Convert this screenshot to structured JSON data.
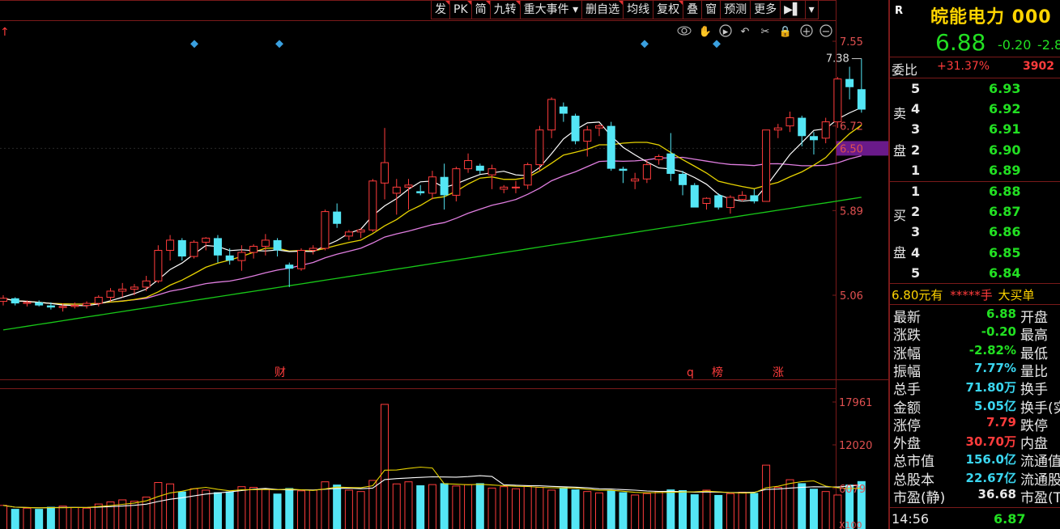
{
  "toolbar": {
    "buttons": [
      {
        "name": "fa",
        "label": "发"
      },
      {
        "name": "pk",
        "label": "PK"
      },
      {
        "name": "jian",
        "label": "简"
      },
      {
        "name": "jiuzhuan",
        "label": "九转"
      },
      {
        "name": "zhongda",
        "label": "重大事件 ▾"
      },
      {
        "name": "shanzixuan",
        "label": "删自选"
      },
      {
        "name": "junxian",
        "label": "均线"
      },
      {
        "name": "fuquan",
        "label": "复权"
      },
      {
        "name": "die",
        "label": "叠"
      },
      {
        "name": "chuang",
        "label": "窗"
      },
      {
        "name": "yuce",
        "label": "预测"
      },
      {
        "name": "gengduo",
        "label": "更多"
      },
      {
        "name": "expand",
        "label": "▶▌"
      },
      {
        "name": "menu",
        "label": "▾"
      }
    ]
  },
  "chart_icons": [
    "eye-icon",
    "hand-icon",
    "play-icon",
    "undo-icon",
    "scissors-icon",
    "lock-icon",
    "zoom-in-icon",
    "zoom-out-icon"
  ],
  "price_axis": {
    "labels": [
      "7.55",
      "6.72",
      "6.50",
      "5.89",
      "5.06"
    ],
    "highlight": "6.50"
  },
  "volume_axis": {
    "labels": [
      "17961",
      "12020",
      "6079",
      "X100"
    ]
  },
  "markers": {
    "cai": "财",
    "q": "q",
    "bang": "榜",
    "zhang": "涨"
  },
  "high_label": "7.38",
  "up_arrow": "↑",
  "colors": {
    "up": "#ff3c3c",
    "down": "#54e6f5",
    "ma5": "#ffffff",
    "ma10": "#e6d200",
    "ma20": "#e07ee0",
    "ma60": "#18c818",
    "frame": "#7a1a1a"
  },
  "chart_data": {
    "type": "candlestick",
    "y_range": [
      5.06,
      7.55
    ],
    "y_ticks": [
      7.55,
      6.72,
      5.89,
      5.06
    ],
    "current_price_line": 6.5,
    "ohlc": [
      [
        5.0,
        5.06,
        4.96,
        5.03
      ],
      [
        5.03,
        5.04,
        4.96,
        4.98
      ],
      [
        4.98,
        5.01,
        4.95,
        4.99
      ],
      [
        4.99,
        5.01,
        4.95,
        4.96
      ],
      [
        4.96,
        4.99,
        4.92,
        4.94
      ],
      [
        4.94,
        4.98,
        4.9,
        4.95
      ],
      [
        4.95,
        4.99,
        4.93,
        4.96
      ],
      [
        4.96,
        5.0,
        4.93,
        4.98
      ],
      [
        4.98,
        5.06,
        4.95,
        5.04
      ],
      [
        5.04,
        5.13,
        5.0,
        5.1
      ],
      [
        5.1,
        5.18,
        5.04,
        5.12
      ],
      [
        5.12,
        5.17,
        5.06,
        5.14
      ],
      [
        5.14,
        5.25,
        5.1,
        5.2
      ],
      [
        5.2,
        5.55,
        5.18,
        5.5
      ],
      [
        5.5,
        5.65,
        5.4,
        5.6
      ],
      [
        5.6,
        5.62,
        5.4,
        5.44
      ],
      [
        5.44,
        5.6,
        5.42,
        5.58
      ],
      [
        5.58,
        5.63,
        5.5,
        5.62
      ],
      [
        5.62,
        5.65,
        5.38,
        5.45
      ],
      [
        5.45,
        5.52,
        5.36,
        5.4
      ],
      [
        5.4,
        5.55,
        5.3,
        5.48
      ],
      [
        5.48,
        5.56,
        5.42,
        5.54
      ],
      [
        5.54,
        5.66,
        5.45,
        5.6
      ],
      [
        5.6,
        5.62,
        5.44,
        5.5
      ],
      [
        5.36,
        5.38,
        5.14,
        5.32
      ],
      [
        5.32,
        5.52,
        5.3,
        5.5
      ],
      [
        5.5,
        5.55,
        5.46,
        5.52
      ],
      [
        5.52,
        5.9,
        5.5,
        5.88
      ],
      [
        5.88,
        5.96,
        5.72,
        5.76
      ],
      [
        5.64,
        5.7,
        5.6,
        5.68
      ],
      [
        5.68,
        5.72,
        5.62,
        5.7
      ],
      [
        5.7,
        6.2,
        5.68,
        6.18
      ],
      [
        6.16,
        6.7,
        6.0,
        6.36
      ],
      [
        6.06,
        6.2,
        5.85,
        6.12
      ],
      [
        6.12,
        6.2,
        5.9,
        6.14
      ],
      [
        6.08,
        6.14,
        6.04,
        6.06
      ],
      [
        6.06,
        6.28,
        6.0,
        6.22
      ],
      [
        6.22,
        6.35,
        5.9,
        6.04
      ],
      [
        6.04,
        6.32,
        5.98,
        6.3
      ],
      [
        6.3,
        6.45,
        6.26,
        6.38
      ],
      [
        6.33,
        6.35,
        6.25,
        6.28
      ],
      [
        6.24,
        6.34,
        6.1,
        6.3
      ],
      [
        6.1,
        6.14,
        6.06,
        6.12
      ],
      [
        6.12,
        6.18,
        6.06,
        6.12
      ],
      [
        6.14,
        6.36,
        6.1,
        6.34
      ],
      [
        6.34,
        6.72,
        6.28,
        6.68
      ],
      [
        6.68,
        7.0,
        6.6,
        6.98
      ],
      [
        6.91,
        6.95,
        6.76,
        6.84
      ],
      [
        6.82,
        6.84,
        6.54,
        6.57
      ],
      [
        6.57,
        6.72,
        6.42,
        6.68
      ],
      [
        6.7,
        6.74,
        6.62,
        6.72
      ],
      [
        6.72,
        6.76,
        6.28,
        6.3
      ],
      [
        6.3,
        6.32,
        6.16,
        6.28
      ],
      [
        6.18,
        6.26,
        6.1,
        6.2
      ],
      [
        6.2,
        6.38,
        6.16,
        6.34
      ],
      [
        6.39,
        6.44,
        6.34,
        6.42
      ],
      [
        6.45,
        6.65,
        6.18,
        6.25
      ],
      [
        6.25,
        6.28,
        6.04,
        6.14
      ],
      [
        6.14,
        6.16,
        5.96,
        5.92
      ],
      [
        5.96,
        6.02,
        5.9,
        6.01
      ],
      [
        6.04,
        6.06,
        5.9,
        5.92
      ],
      [
        5.92,
        6.04,
        5.86,
        6.02
      ],
      [
        6.0,
        6.08,
        5.98,
        6.04
      ],
      [
        6.04,
        6.1,
        5.96,
        5.98
      ],
      [
        5.98,
        6.5,
        5.98,
        6.68
      ],
      [
        6.68,
        6.74,
        6.6,
        6.7
      ],
      [
        6.72,
        6.86,
        6.66,
        6.8
      ],
      [
        6.8,
        6.82,
        6.52,
        6.62
      ],
      [
        6.62,
        6.66,
        6.44,
        6.58
      ],
      [
        6.6,
        6.8,
        6.55,
        6.76
      ],
      [
        6.76,
        7.2,
        6.7,
        7.18
      ],
      [
        7.18,
        7.3,
        6.98,
        7.1
      ],
      [
        7.08,
        7.38,
        6.85,
        6.88
      ]
    ],
    "volume": [
      3.4,
      2.9,
      3.0,
      2.9,
      3.2,
      3.3,
      3.1,
      3.0,
      3.6,
      3.9,
      4.2,
      4.0,
      4.6,
      6.7,
      6.5,
      5.4,
      5.8,
      5.6,
      5.3,
      5.4,
      6.1,
      6.0,
      5.7,
      5.1,
      5.9,
      5.5,
      5.6,
      6.8,
      6.4,
      5.6,
      5.4,
      7.0,
      17.96,
      6.5,
      6.8,
      6.3,
      6.4,
      6.6,
      6.2,
      6.4,
      6.6,
      5.9,
      6.1,
      5.8,
      6.2,
      6.0,
      5.6,
      6.0,
      5.7,
      5.4,
      5.2,
      5.6,
      5.3,
      4.9,
      5.1,
      5.4,
      5.7,
      5.6,
      5.0,
      5.6,
      4.9,
      5.1,
      5.3,
      5.2,
      9.2,
      6.0,
      7.1,
      6.6,
      5.8,
      5.4,
      4.9,
      6.4,
      6.9
    ],
    "ma_lines": [
      "MA5",
      "MA10",
      "MA20",
      "MA60"
    ]
  },
  "panel": {
    "logo": "R",
    "name": "皖能电力 000",
    "price": "6.88",
    "change": "-0.20",
    "pct": "-2.8",
    "weibi_label": "委比",
    "weibi_value": "+31.37%",
    "weibi_diff": "3902",
    "sell_label_1": "卖",
    "sell_label_2": "盘",
    "buy_label_1": "买",
    "buy_label_2": "盘",
    "sell": [
      {
        "lvl": "5",
        "price": "6.93"
      },
      {
        "lvl": "4",
        "price": "6.92"
      },
      {
        "lvl": "3",
        "price": "6.91"
      },
      {
        "lvl": "2",
        "price": "6.90"
      },
      {
        "lvl": "1",
        "price": "6.89"
      }
    ],
    "buy": [
      {
        "lvl": "1",
        "price": "6.88"
      },
      {
        "lvl": "2",
        "price": "6.87"
      },
      {
        "lvl": "3",
        "price": "6.86"
      },
      {
        "lvl": "4",
        "price": "6.85"
      },
      {
        "lvl": "5",
        "price": "6.84"
      }
    ],
    "notice_price": "6.80",
    "notice_text": "元有",
    "notice_vol": "*****手",
    "notice_big": "大买单",
    "stats": [
      {
        "k": "最新",
        "v": "6.88",
        "c": "green",
        "k2": "开盘"
      },
      {
        "k": "涨跌",
        "v": "-0.20",
        "c": "green",
        "k2": "最高"
      },
      {
        "k": "涨幅",
        "v": "-2.82%",
        "c": "green",
        "k2": "最低"
      },
      {
        "k": "振幅",
        "v": "7.77%",
        "c": "cyan",
        "k2": "量比"
      },
      {
        "k": "总手",
        "v": "71.80万",
        "c": "cyan",
        "k2": "换手"
      },
      {
        "k": "金额",
        "v": "5.05亿",
        "c": "cyan",
        "k2": "换手(实"
      },
      {
        "k": "涨停",
        "v": "7.79",
        "c": "red",
        "k2": "跌停"
      },
      {
        "k": "外盘",
        "v": "30.70万",
        "c": "red",
        "k2": "内盘"
      },
      {
        "k": "总市值",
        "v": "156.0亿",
        "c": "cyan",
        "k2": "流通值"
      },
      {
        "k": "总股本",
        "v": "22.67亿",
        "c": "cyan",
        "k2": "流通股"
      },
      {
        "k": "市盈(静)",
        "v": "36.68",
        "c": "white",
        "k2": "市盈(T"
      }
    ],
    "time": "14:56",
    "time_price": "6.87"
  }
}
